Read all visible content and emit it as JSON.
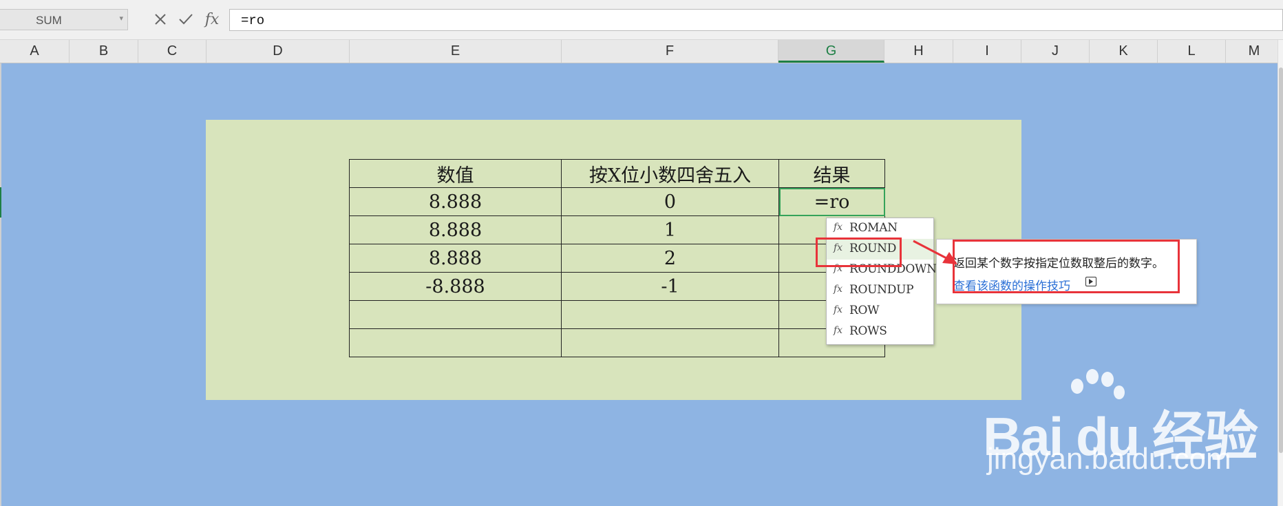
{
  "formula_bar": {
    "name_box": "SUM",
    "cancel_icon": "cancel-icon",
    "confirm_icon": "check-icon",
    "fx_label": "fx",
    "formula": "=ro"
  },
  "columns": [
    {
      "label": "A"
    },
    {
      "label": "B"
    },
    {
      "label": "C"
    },
    {
      "label": "D"
    },
    {
      "label": "E"
    },
    {
      "label": "F"
    },
    {
      "label": "G",
      "selected": true
    },
    {
      "label": "H"
    },
    {
      "label": "I"
    },
    {
      "label": "J"
    },
    {
      "label": "K"
    },
    {
      "label": "L"
    },
    {
      "label": "M"
    }
  ],
  "table": {
    "headers": [
      "数值",
      "按X位小数四舍五入",
      "结果"
    ],
    "rows": [
      [
        "8.888",
        "0",
        "=ro"
      ],
      [
        "8.888",
        "1",
        ""
      ],
      [
        "8.888",
        "2",
        ""
      ],
      [
        "-8.888",
        "-1",
        ""
      ],
      [
        "",
        "",
        ""
      ],
      [
        "",
        "",
        ""
      ]
    ]
  },
  "autocomplete": {
    "icon_label": "fx",
    "items": [
      "ROMAN",
      "ROUND",
      "ROUNDDOWN",
      "ROUNDUP",
      "ROW",
      "ROWS"
    ],
    "selected": "ROUND"
  },
  "tooltip": {
    "description": "返回某个数字按指定位数取整后的数字。",
    "link": "查看该函数的操作技巧"
  },
  "colors": {
    "sheet_bg": "#8eb4e3",
    "panel_bg": "#d8e4bc",
    "highlight": "#e8333a",
    "selected_column": "#1e7f45",
    "link": "#2a6fd6"
  },
  "watermark": {
    "brand": "Bai du 经验",
    "url": "jingyan.baidu.com"
  }
}
